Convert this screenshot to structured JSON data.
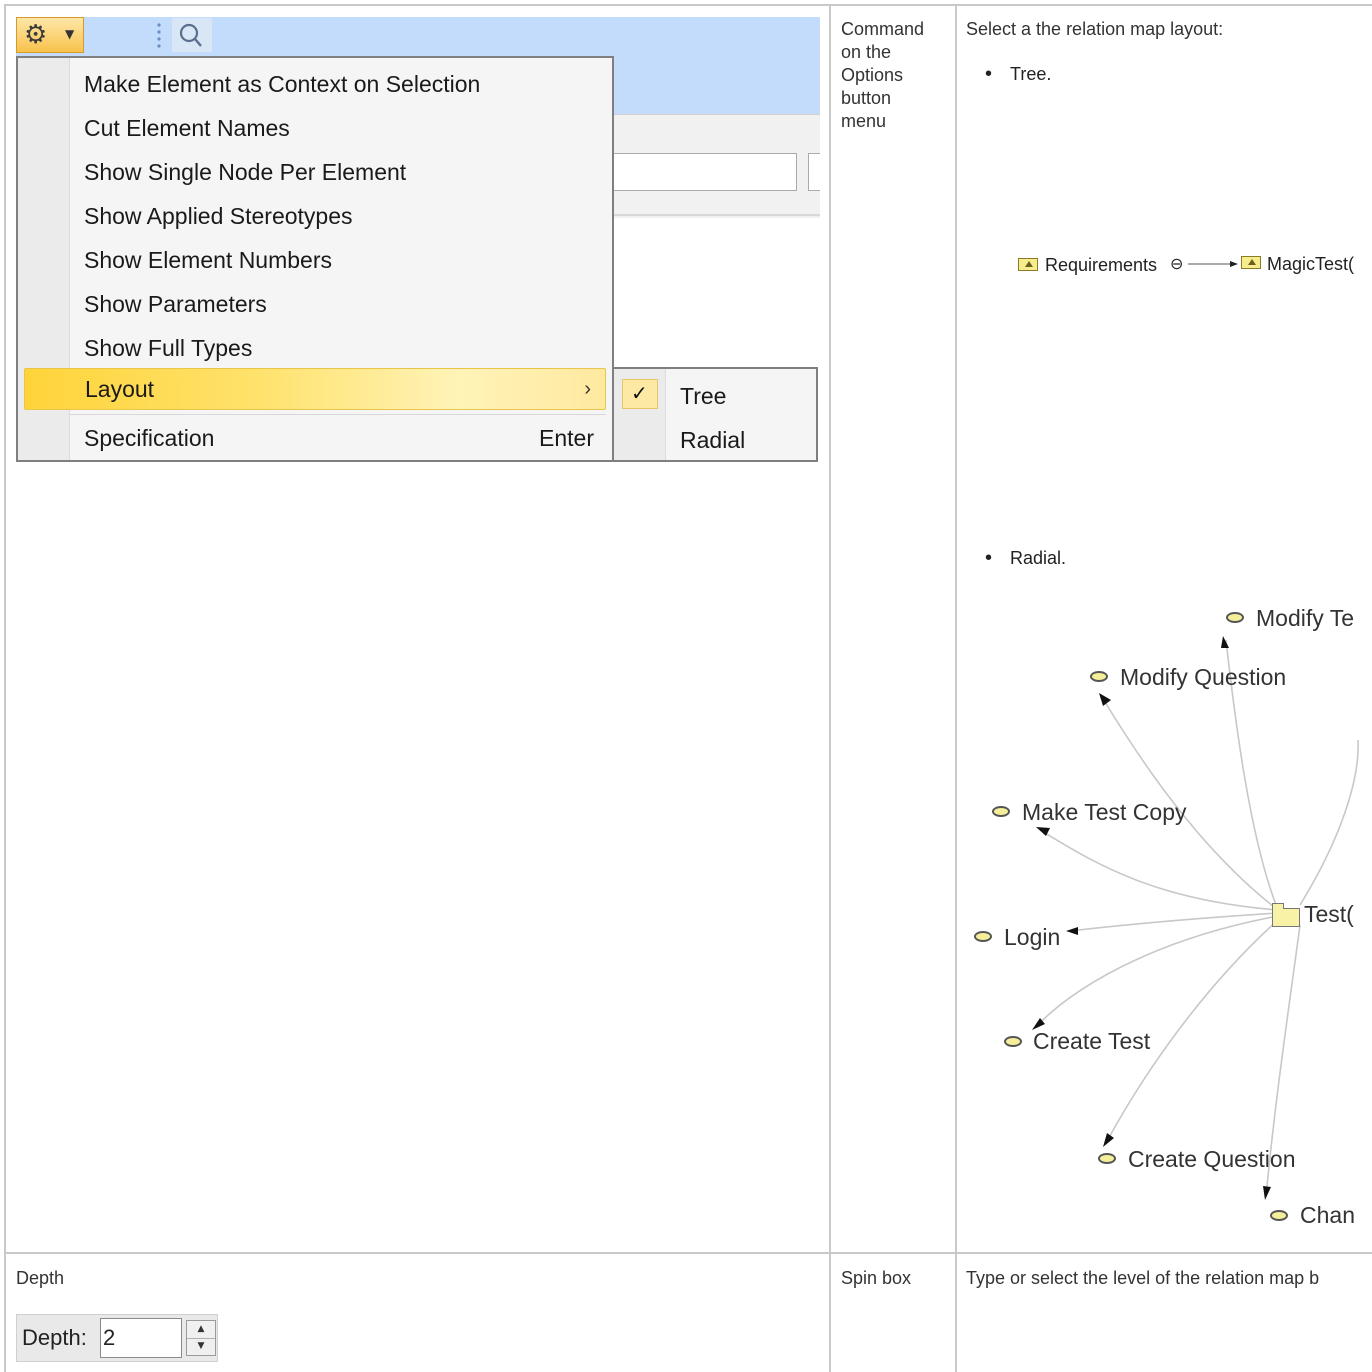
{
  "row1": {
    "col2_text": "Command on the Options button menu",
    "col2_lines": [
      "Command",
      "on the",
      "Options",
      "button",
      "menu"
    ],
    "col3_intro": "Select a the relation map layout:",
    "bullet_tree": "Tree.",
    "bullet_radial": "Radial."
  },
  "menu": {
    "items": [
      {
        "label": "Make Element as Context on Selection"
      },
      {
        "label": "Cut Element Names"
      },
      {
        "label": "Show Single Node Per Element"
      },
      {
        "label": "Show Applied Stereotypes"
      },
      {
        "label": "Show Element Numbers"
      },
      {
        "label": "Show Parameters"
      },
      {
        "label": "Show Full Types"
      },
      {
        "label": "Layout",
        "arrow": "›"
      },
      {
        "label": "Specification",
        "shortcut": "Enter"
      }
    ],
    "selected": "Layout"
  },
  "submenu": {
    "items": [
      {
        "label": "Tree",
        "checked": true
      },
      {
        "label": "Radial",
        "checked": false
      }
    ],
    "check_glyph": "✓"
  },
  "tree_diagram": {
    "nodes": [
      "Requirements",
      "MagicTest("
    ],
    "collapse_glyph": "⊖"
  },
  "radial_diagram": {
    "center": "Test(",
    "nodes": [
      "Modify Te",
      "Modify Question",
      "Make Test Copy",
      "Login",
      "Create Test",
      "Create Question",
      "Chan"
    ]
  },
  "row2": {
    "col1_title": "Depth",
    "col2_text": "Spin box",
    "col3_text": "Type or select the level of the relation map b",
    "depth_label": "Depth:",
    "depth_value": "2"
  },
  "icons": {
    "gear": "gear-icon",
    "search": "search-icon",
    "check": "check-icon"
  }
}
